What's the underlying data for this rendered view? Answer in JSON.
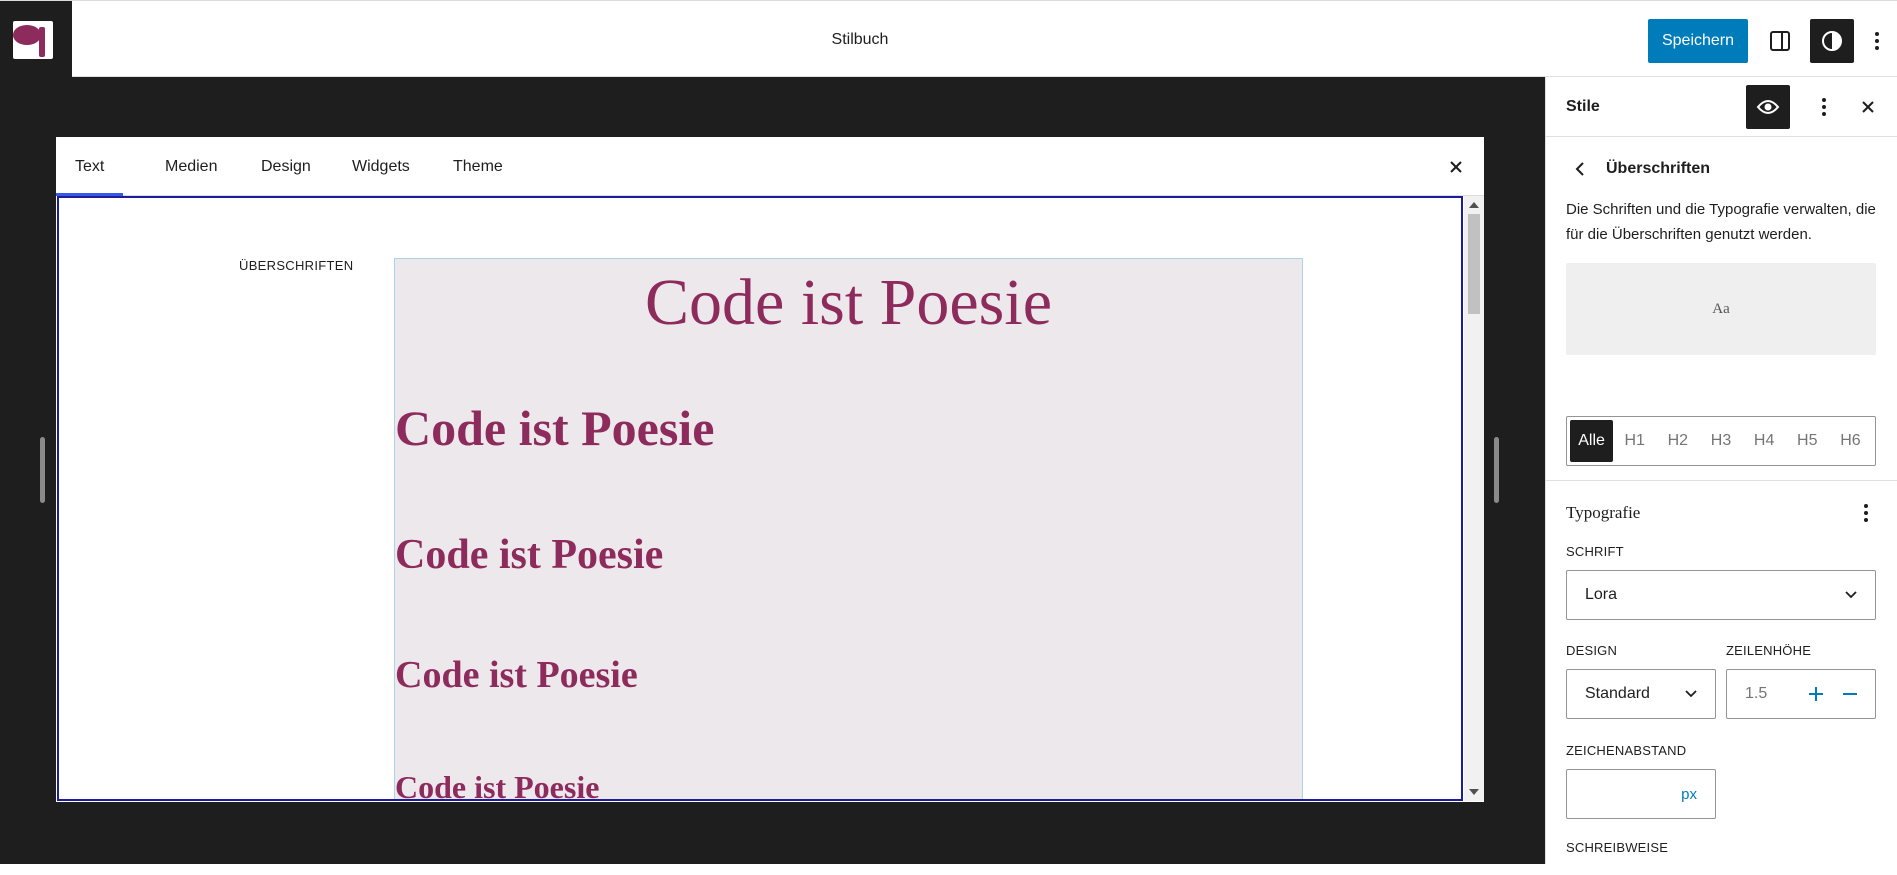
{
  "header": {
    "document_title": "Stilbuch",
    "save_label": "Speichern"
  },
  "stylebook": {
    "tabs": [
      {
        "label": "Text",
        "active": true
      },
      {
        "label": "Medien",
        "active": false
      },
      {
        "label": "Design",
        "active": false
      },
      {
        "label": "Widgets",
        "active": false
      },
      {
        "label": "Theme",
        "active": false
      }
    ],
    "section_label": "ÜBERSCHRIFTEN",
    "headings": {
      "h1": "Code ist Poesie",
      "h2": "Code ist Poesie",
      "h3": "Code ist Poesie",
      "h4": "Code ist Poesie",
      "h5": "Code ist Poesie"
    }
  },
  "sidebar": {
    "title": "Stile",
    "panel_title": "Überschriften",
    "description": "Die Schriften und die Typografie verwalten, die für die Überschriften genutzt werden.",
    "preview_text": "Aa",
    "levels": [
      "Alle",
      "H1",
      "H2",
      "H3",
      "H4",
      "H5",
      "H6"
    ],
    "active_level": "Alle",
    "typography": {
      "section_title": "Typografie",
      "font_label": "SCHRIFT",
      "font_value": "Lora",
      "appearance_label": "DESIGN",
      "appearance_value": "Standard",
      "line_height_label": "ZEILENHÖHE",
      "line_height_value": "1.5",
      "letter_spacing_label": "ZEICHENABSTAND",
      "letter_spacing_unit": "px",
      "letter_case_label": "SCHREIBWEISE"
    }
  },
  "colors": {
    "accent": "#007cba",
    "heading": "#8d2b5c",
    "tab_indicator": "#3858e9"
  }
}
